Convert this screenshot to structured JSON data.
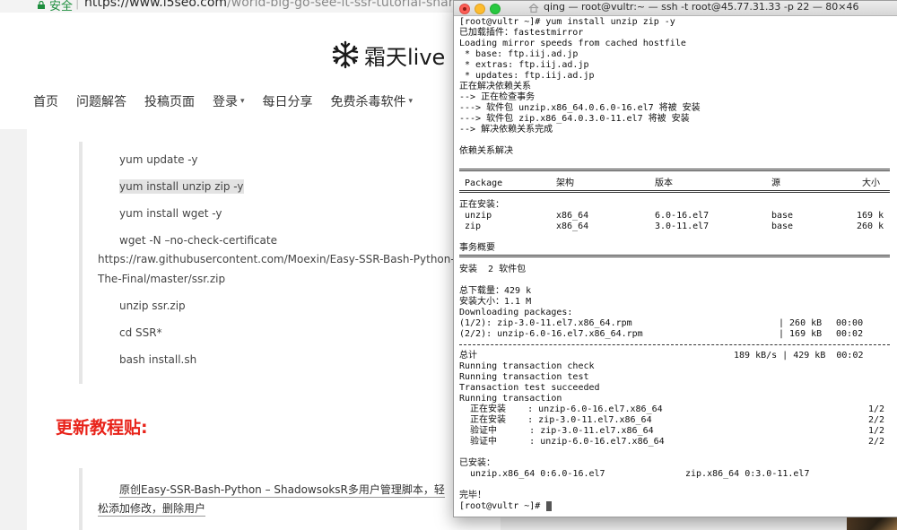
{
  "browser": {
    "secure_label": "安全",
    "url_host": "https://www.i5seo.com",
    "url_path": "/world-big-go-see-it-ssr-tutorial-share-from-ladder"
  },
  "site": {
    "logo_text": "霜天live",
    "nav": [
      {
        "label": "首页",
        "dropdown": false
      },
      {
        "label": "问题解答",
        "dropdown": false
      },
      {
        "label": "投稿页面",
        "dropdown": false
      },
      {
        "label": "登录",
        "dropdown": true
      },
      {
        "label": "每日分享",
        "dropdown": false
      },
      {
        "label": "免费杀毒软件",
        "dropdown": true
      }
    ]
  },
  "article": {
    "lines": [
      "yum update -y",
      "yum install unzip zip -y",
      "yum install wget -y",
      "wget -N –no-check-certificate",
      "https://raw.githubusercontent.com/Moexin/Easy-SSR-Bash-Python-",
      "The-Final/master/ssr.zip",
      "unzip ssr.zip",
      "cd SSR*",
      "bash install.sh"
    ],
    "update_title": "更新教程贴:",
    "link_line1": "原创Easy-SSR-Bash-Python – ShadowsoksR多用户管理脚本，轻",
    "link_line2": "松添加修改，删除用户"
  },
  "terminal": {
    "title": "qing — root@vultr:~ — ssh -t root@45.77.31.33 -p 22 — 80×46",
    "lines": [
      "[root@vultr ~]# yum install unzip zip -y",
      "已加载插件：fastestmirror",
      "Loading mirror speeds from cached hostfile",
      " * base: ftp.iij.ad.jp",
      " * extras: ftp.iij.ad.jp",
      " * updates: ftp.iij.ad.jp",
      "正在解决依赖关系",
      "--> 正在检查事务",
      "---> 软件包 unzip.x86_64.0.6.0-16.el7 将被 安装",
      "---> 软件包 zip.x86_64.0.3.0-11.el7 将被 安装",
      "--> 解决依赖关系完成",
      "",
      "依赖关系解决"
    ],
    "table_header": {
      "package": "Package",
      "arch": "架构",
      "version": "版本",
      "repo": "源",
      "size": "大小"
    },
    "installing_label": "正在安装：",
    "packages": [
      {
        "name": "unzip",
        "arch": "x86_64",
        "version": "6.0-16.el7",
        "repo": "base",
        "size": "169 k"
      },
      {
        "name": "zip",
        "arch": "x86_64",
        "version": "3.0-11.el7",
        "repo": "base",
        "size": "260 k"
      }
    ],
    "summary_label": "事务概要",
    "install_count": "安装  2 软件包",
    "download_size": "总下载量：429 k",
    "installed_size": "安装大小：1.1 M",
    "downloading": "Downloading packages:",
    "downloads": [
      {
        "name": "(1/2): zip-3.0-11.el7.x86_64.rpm",
        "size": "| 260 kB",
        "time": "00:00"
      },
      {
        "name": "(2/2): unzip-6.0-16.el7.x86_64.rpm",
        "size": "| 169 kB",
        "time": "00:02"
      }
    ],
    "total_label": "总计",
    "total_value": "189 kB/s | 429 kB  00:02",
    "transaction_lines": [
      "Running transaction check",
      "Running transaction test",
      "Transaction test succeeded",
      "Running transaction"
    ],
    "steps": [
      {
        "action": "  正在安装    : unzip-6.0-16.el7.x86_64",
        "count": "1/2"
      },
      {
        "action": "  正在安装    : zip-3.0-11.el7.x86_64",
        "count": "2/2"
      },
      {
        "action": "  验证中      : zip-3.0-11.el7.x86_64",
        "count": "1/2"
      },
      {
        "action": "  验证中      : unzip-6.0-16.el7.x86_64",
        "count": "2/2"
      }
    ],
    "installed_label": "已安装：",
    "installed_a": "  unzip.x86_64 0:6.0-16.el7",
    "installed_b": "zip.x86_64 0:3.0-11.el7",
    "done": "完毕！",
    "prompt": "[root@vultr ~]# "
  }
}
